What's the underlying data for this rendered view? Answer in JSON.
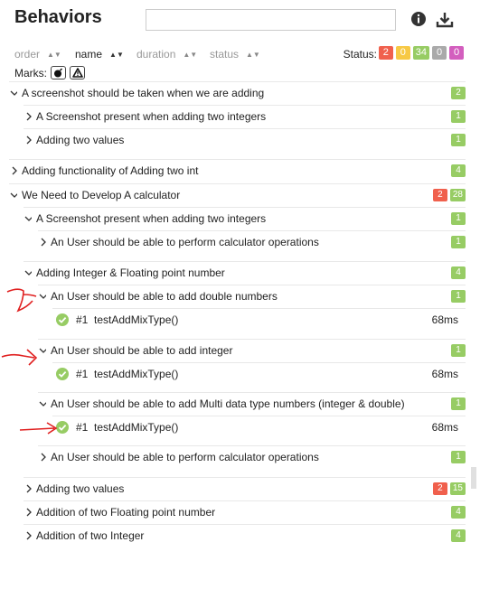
{
  "header": {
    "title": "Behaviors",
    "search_placeholder": "",
    "info_icon": "info-icon",
    "download_icon": "download-icon"
  },
  "sort": {
    "order": "order",
    "name": "name",
    "duration": "duration",
    "status": "status",
    "active": "name"
  },
  "status": {
    "label": "Status:",
    "counts": [
      {
        "value": "2",
        "color": "#f0604d"
      },
      {
        "value": "0",
        "color": "#f7c945"
      },
      {
        "value": "34",
        "color": "#97cc64"
      },
      {
        "value": "0",
        "color": "#aaaaaa"
      },
      {
        "value": "0",
        "color": "#d35ebe"
      }
    ]
  },
  "marks": {
    "label": "Marks:",
    "items": [
      "bomb-icon",
      "warning-icon"
    ]
  },
  "tree": [
    {
      "kind": "group",
      "level": 0,
      "expanded": true,
      "label": "A screenshot should be taken when we are adding",
      "counts": [
        {
          "v": "2",
          "c": "green"
        }
      ]
    },
    {
      "kind": "group",
      "level": 1,
      "expanded": false,
      "label": "A Screenshot present when adding two integers",
      "counts": [
        {
          "v": "1",
          "c": "green"
        }
      ]
    },
    {
      "kind": "group",
      "level": 1,
      "expanded": false,
      "label": "Adding two values",
      "counts": [
        {
          "v": "1",
          "c": "green"
        }
      ]
    },
    {
      "kind": "group",
      "level": 0,
      "expanded": false,
      "label": "Adding functionality of Adding two int",
      "counts": [
        {
          "v": "4",
          "c": "green"
        }
      ]
    },
    {
      "kind": "group",
      "level": 0,
      "expanded": true,
      "label": "We Need to Develop A calculator",
      "counts": [
        {
          "v": "2",
          "c": "red"
        },
        {
          "v": "28",
          "c": "green"
        }
      ]
    },
    {
      "kind": "group",
      "level": 1,
      "expanded": true,
      "label": "A Screenshot present when adding two integers",
      "counts": [
        {
          "v": "1",
          "c": "green"
        }
      ]
    },
    {
      "kind": "group",
      "level": 2,
      "expanded": false,
      "label": "An User should be able to perform calculator operations",
      "counts": [
        {
          "v": "1",
          "c": "green"
        }
      ]
    },
    {
      "kind": "group",
      "level": 1,
      "expanded": true,
      "label": "Adding Integer & Floating point number",
      "counts": [
        {
          "v": "4",
          "c": "green"
        }
      ]
    },
    {
      "kind": "group",
      "level": 2,
      "expanded": true,
      "label": "An User should be able to add double numbers",
      "counts": [
        {
          "v": "1",
          "c": "green"
        }
      ]
    },
    {
      "kind": "leaf",
      "level": 2,
      "num": "#1",
      "label": "testAddMixType()",
      "duration": "68ms"
    },
    {
      "kind": "group",
      "level": 2,
      "expanded": true,
      "label": "An User should be able to add integer",
      "counts": [
        {
          "v": "1",
          "c": "green"
        }
      ]
    },
    {
      "kind": "leaf",
      "level": 2,
      "num": "#1",
      "label": "testAddMixType()",
      "duration": "68ms"
    },
    {
      "kind": "group",
      "level": 2,
      "expanded": true,
      "label": "An User should be able to add Multi data type numbers (integer & double)",
      "counts": [
        {
          "v": "1",
          "c": "green"
        }
      ]
    },
    {
      "kind": "leaf",
      "level": 2,
      "num": "#1",
      "label": "testAddMixType()",
      "duration": "68ms"
    },
    {
      "kind": "group",
      "level": 2,
      "expanded": false,
      "label": "An User should be able to perform calculator operations",
      "counts": [
        {
          "v": "1",
          "c": "green"
        }
      ]
    },
    {
      "kind": "group",
      "level": 1,
      "expanded": false,
      "label": "Adding two values",
      "counts": [
        {
          "v": "2",
          "c": "red"
        },
        {
          "v": "15",
          "c": "green"
        }
      ]
    },
    {
      "kind": "group",
      "level": 1,
      "expanded": false,
      "label": "Addition of two Floating point number",
      "counts": [
        {
          "v": "4",
          "c": "green"
        }
      ]
    },
    {
      "kind": "group",
      "level": 1,
      "expanded": false,
      "label": "Addition of two Integer",
      "counts": [
        {
          "v": "4",
          "c": "green"
        }
      ]
    }
  ]
}
